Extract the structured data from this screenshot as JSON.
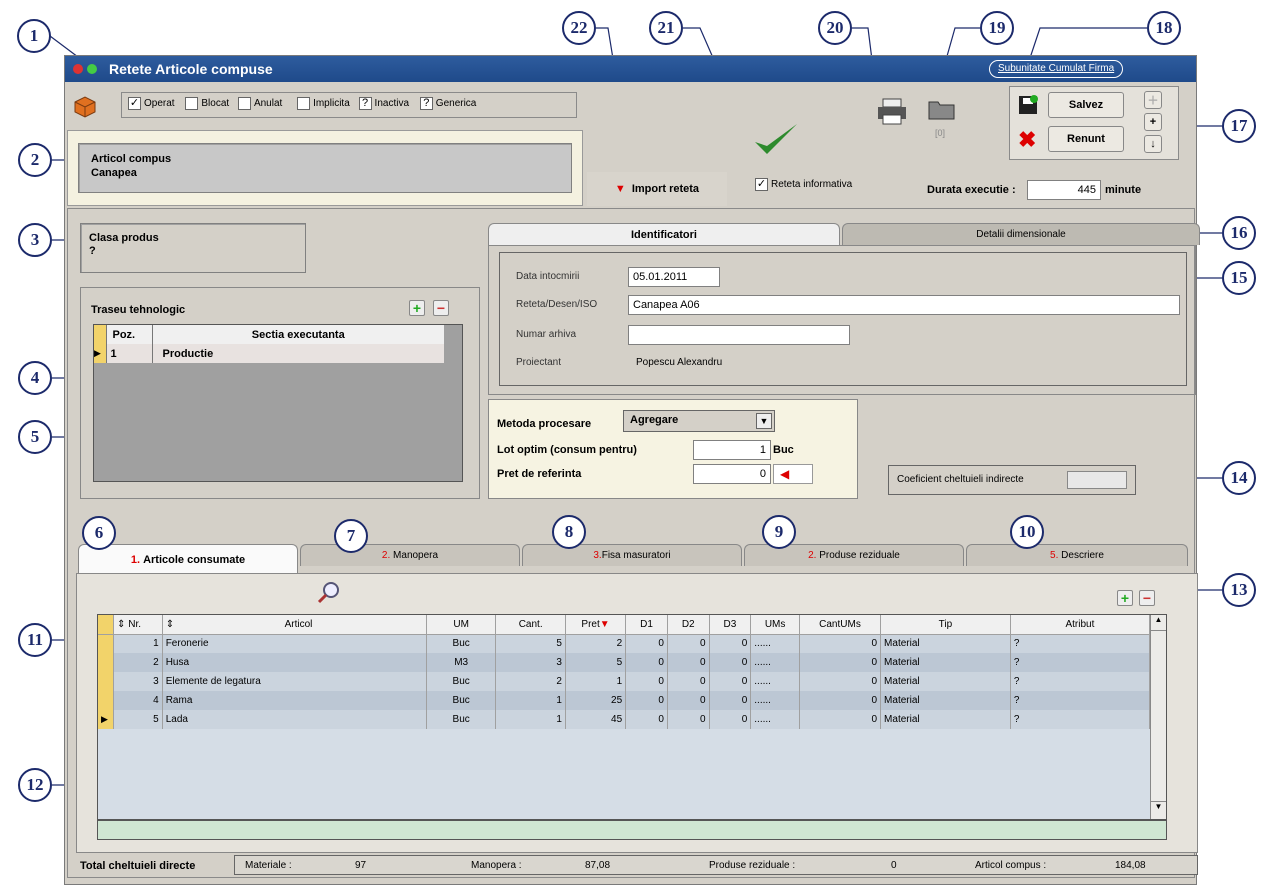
{
  "window": {
    "title": "Retete Articole compuse",
    "subunit_label": "Subunitate Cumulat Firma"
  },
  "status": {
    "operat": "Operat",
    "blocat": "Blocat",
    "anulat": "Anulat",
    "implicita": "Implicita",
    "inactiva": "Inactiva",
    "generica": "Generica",
    "unknown_mark": "?"
  },
  "article": {
    "label": "Articol compus",
    "value": "Canapea"
  },
  "import_label": "Import reteta",
  "informativa_label": "Reteta informativa",
  "printer_counter": "[0]",
  "actions": {
    "save": "Salvez",
    "cancel": "Renunt"
  },
  "duration": {
    "label": "Durata executie :",
    "value": "445",
    "unit": "minute"
  },
  "clasa": {
    "label": "Clasa produs",
    "value": "?"
  },
  "traseu": {
    "title": "Traseu tehnologic",
    "col_poz": "Poz.",
    "col_sectia": "Sectia executanta",
    "rows": [
      {
        "poz": "1",
        "sectia": "Productie"
      }
    ]
  },
  "id_tabs": {
    "identificatori": "Identificatori",
    "detalii": "Detalii dimensionale"
  },
  "ident": {
    "data_label": "Data intocmirii",
    "data_value": "05.01.2011",
    "reteta_label": "Reteta/Desen/ISO",
    "reteta_value": "Canapea A06",
    "arhiva_label": "Numar arhiva",
    "arhiva_value": "",
    "proiectant_label": "Proiectant",
    "proiectant_value": "Popescu Alexandru"
  },
  "metoda": {
    "label": "Metoda procesare",
    "value": "Agregare",
    "lot_label": "Lot optim (consum pentru)",
    "lot_value": "1",
    "lot_unit": "Buc",
    "pret_label": "Pret de referinta",
    "pret_value": "0"
  },
  "coeficient_label": "Coeficient cheltuieli indirecte",
  "bottom_tabs": [
    {
      "num": "1.",
      "label": "Articole consumate"
    },
    {
      "num": "2.",
      "label": "Manopera"
    },
    {
      "num": "3.",
      "label": "Fisa masuratori"
    },
    {
      "num": "2.",
      "label": "Produse reziduale"
    },
    {
      "num": "5.",
      "label": "Descriere"
    }
  ],
  "grid": {
    "columns": [
      "Nr.",
      "Articol",
      "UM",
      "Cant.",
      "Pret",
      "D1",
      "D2",
      "D3",
      "UMs",
      "CantUMs",
      "Tip",
      "Atribut"
    ],
    "rows": [
      {
        "nr": "1",
        "articol": "Feronerie",
        "um": "Buc",
        "cant": "5",
        "pret": "2",
        "d1": "0",
        "d2": "0",
        "d3": "0",
        "ums": "......",
        "cantums": "0",
        "tip": "Material",
        "atribut": "?"
      },
      {
        "nr": "2",
        "articol": "Husa",
        "um": "M3",
        "cant": "3",
        "pret": "5",
        "d1": "0",
        "d2": "0",
        "d3": "0",
        "ums": "......",
        "cantums": "0",
        "tip": "Material",
        "atribut": "?"
      },
      {
        "nr": "3",
        "articol": "Elemente de legatura",
        "um": "Buc",
        "cant": "2",
        "pret": "1",
        "d1": "0",
        "d2": "0",
        "d3": "0",
        "ums": "......",
        "cantums": "0",
        "tip": "Material",
        "atribut": "?"
      },
      {
        "nr": "4",
        "articol": "Rama",
        "um": "Buc",
        "cant": "1",
        "pret": "25",
        "d1": "0",
        "d2": "0",
        "d3": "0",
        "ums": "......",
        "cantums": "0",
        "tip": "Material",
        "atribut": "?"
      },
      {
        "nr": "5",
        "articol": "Lada",
        "um": "Buc",
        "cant": "1",
        "pret": "45",
        "d1": "0",
        "d2": "0",
        "d3": "0",
        "ums": "......",
        "cantums": "0",
        "tip": "Material",
        "atribut": "?"
      }
    ]
  },
  "totals": {
    "label": "Total cheltuieli directe",
    "materiale_label": "Materiale :",
    "materiale": "97",
    "manopera_label": "Manopera :",
    "manopera": "87,08",
    "reziduale_label": "Produse reziduale :",
    "reziduale": "0",
    "compus_label": "Articol compus :",
    "compus": "184,08"
  },
  "callouts": [
    "1",
    "2",
    "3",
    "4",
    "5",
    "6",
    "7",
    "8",
    "9",
    "10",
    "11",
    "12",
    "13",
    "14",
    "15",
    "16",
    "17",
    "18",
    "19",
    "20",
    "21",
    "22"
  ],
  "colors": {
    "title_bar": "#1f4a8a",
    "accent_red": "#d00000",
    "grid_row": "#cbd4de",
    "grid_footer": "#cfe6d2"
  }
}
